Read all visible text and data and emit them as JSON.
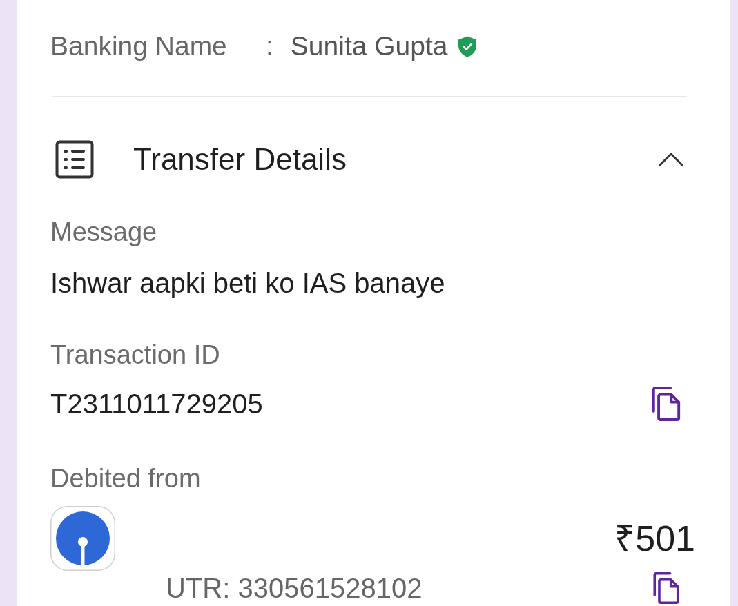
{
  "beneficiary": {
    "label": "Banking Name",
    "separator": ":",
    "name": "Sunita Gupta",
    "verified": true
  },
  "transfer_details": {
    "title": "Transfer Details",
    "expanded": true,
    "fields": [
      {
        "kind": "text",
        "label": "Message",
        "value": "Ishwar aapki beti ko IAS banaye"
      },
      {
        "kind": "copyable",
        "label": "Transaction ID",
        "value": "T2311011729205"
      }
    ],
    "debited_from": {
      "label": "Debited from",
      "amount": "₹501",
      "utr": "UTR: 330561528102"
    }
  }
}
